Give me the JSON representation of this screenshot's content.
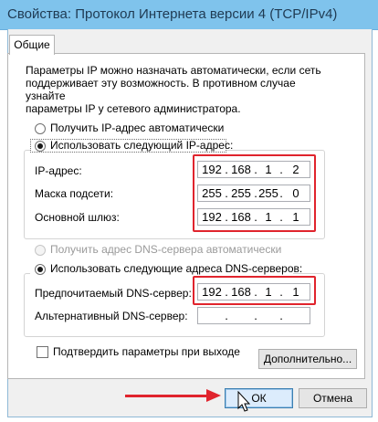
{
  "window": {
    "title": "Свойства: Протокол Интернета версии 4 (TCP/IPv4)"
  },
  "tabs": [
    {
      "label": "Общие"
    }
  ],
  "description": "Параметры IP можно назначать автоматически, если сеть\nподдерживает эту возможность. В противном случае узнайте\nпараметры IP у сетевого администратора.",
  "ip_section": {
    "auto_label": "Получить IP-адрес автоматически",
    "manual_label": "Использовать следующий IP-адрес:",
    "selected": "manual",
    "fields": [
      {
        "label": "IP-адрес:",
        "octets": [
          "192",
          "168",
          "1",
          "2"
        ]
      },
      {
        "label": "Маска подсети:",
        "octets": [
          "255",
          "255",
          "255",
          "0"
        ]
      },
      {
        "label": "Основной шлюз:",
        "octets": [
          "192",
          "168",
          "1",
          "1"
        ]
      }
    ]
  },
  "dns_section": {
    "auto_label": "Получить адрес DNS-сервера автоматически",
    "manual_label": "Использовать следующие адреса DNS-серверов:",
    "selected": "manual",
    "fields": [
      {
        "label": "Предпочитаемый DNS-сервер:",
        "octets": [
          "192",
          "168",
          "1",
          "1"
        ]
      },
      {
        "label": "Альтернативный DNS-сервер:",
        "octets": [
          "",
          "",
          "",
          ""
        ]
      }
    ]
  },
  "validate_on_exit": {
    "label": "Подтвердить параметры при выходе",
    "checked": false
  },
  "buttons": {
    "advanced": "Дополнительно...",
    "ok": "ОК",
    "cancel": "Отмена"
  },
  "colors": {
    "titlebar": "#7fc3ec",
    "highlight": "#e0242d"
  }
}
